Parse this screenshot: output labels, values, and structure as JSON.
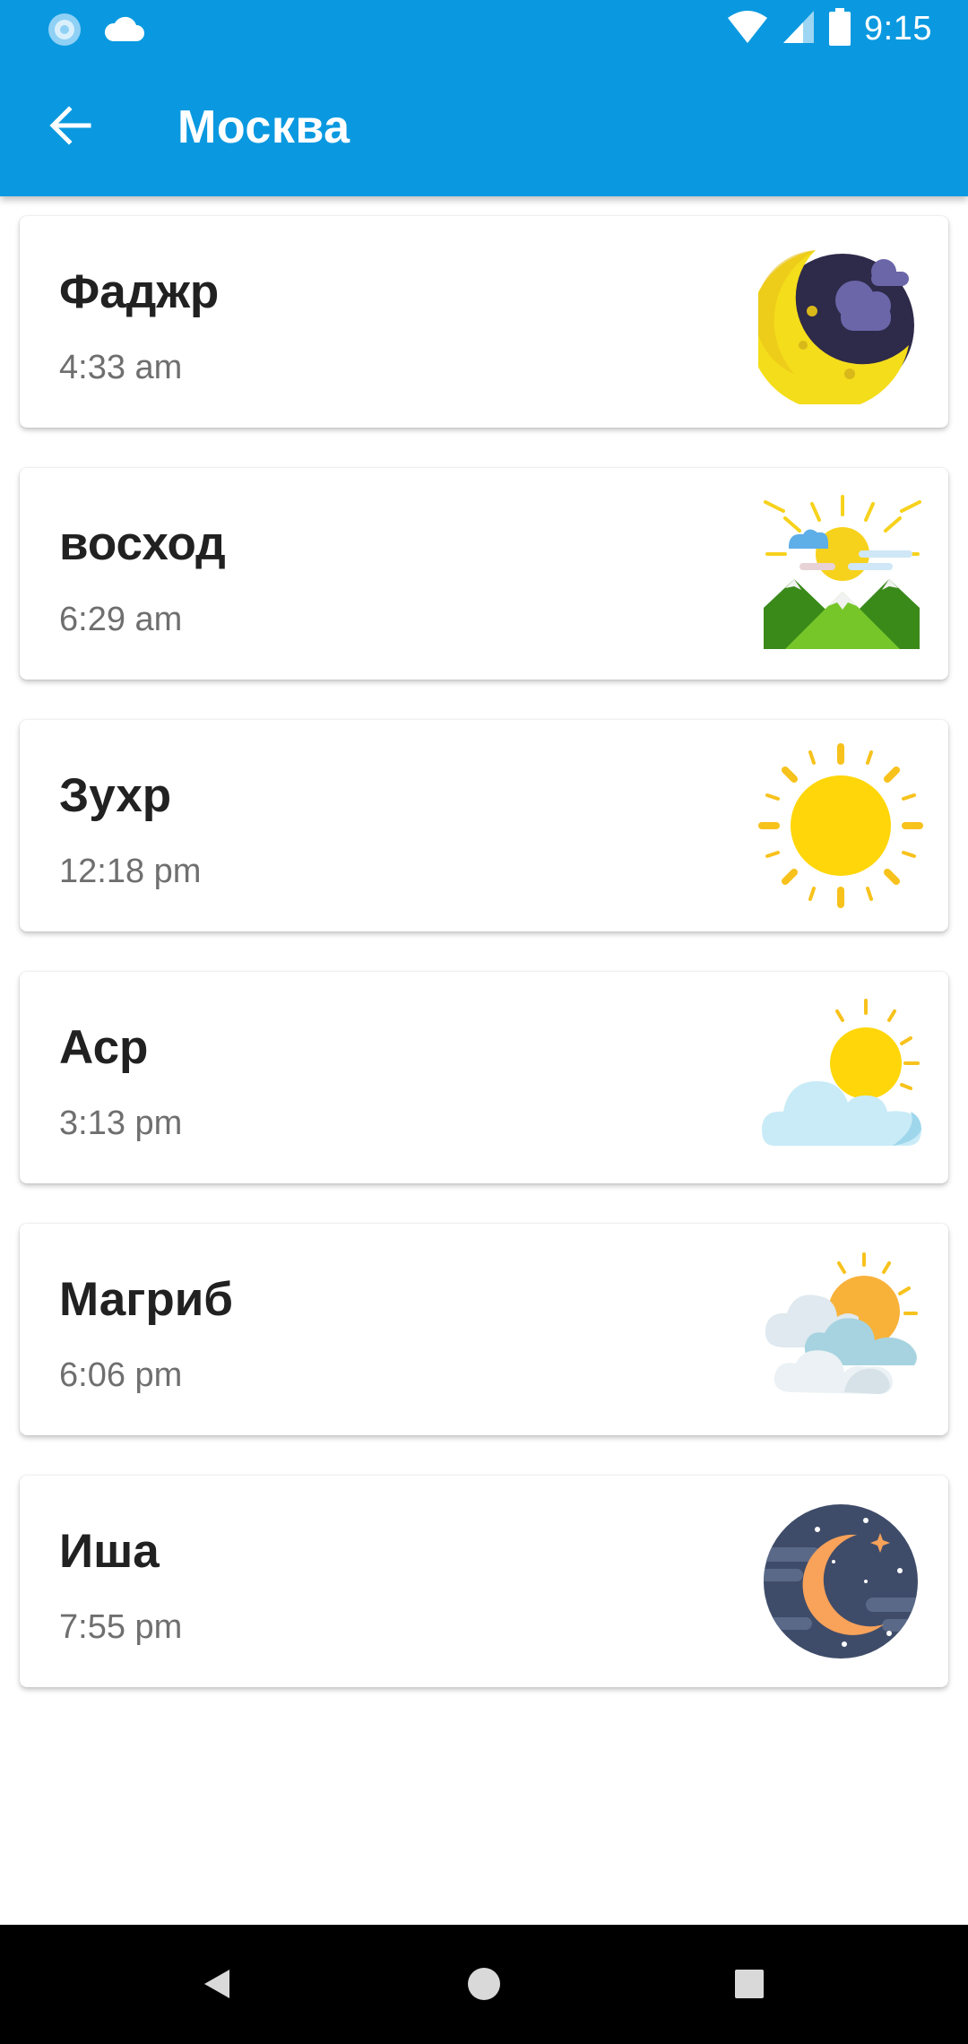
{
  "status_bar": {
    "time": "9:15",
    "left_icons": [
      "app-notification-icon",
      "cloud-icon"
    ],
    "right_icons": [
      "wifi-icon",
      "cell-signal-icon",
      "battery-icon"
    ]
  },
  "app_bar": {
    "title": "Москва",
    "back_icon": "arrow-left-icon"
  },
  "prayers": [
    {
      "name": "Фаджр",
      "time": "4:33 am",
      "icon": "crescent-moon-clouds-icon"
    },
    {
      "name": "восход",
      "time": "6:29 am",
      "icon": "sunrise-mountains-icon"
    },
    {
      "name": "Зухр",
      "time": "12:18 pm",
      "icon": "sun-icon"
    },
    {
      "name": "Аср",
      "time": "3:13 pm",
      "icon": "sun-behind-cloud-icon"
    },
    {
      "name": "Магриб",
      "time": "6:06 pm",
      "icon": "sunset-clouds-icon"
    },
    {
      "name": "Иша",
      "time": "7:55 pm",
      "icon": "night-moon-stars-icon"
    }
  ],
  "nav_bar": {
    "buttons": [
      "back-triangle-icon",
      "home-circle-icon",
      "recents-square-icon"
    ]
  },
  "colors": {
    "primary": "#0a99e0",
    "card_title": "#212121",
    "card_time": "#6f6f6f"
  }
}
